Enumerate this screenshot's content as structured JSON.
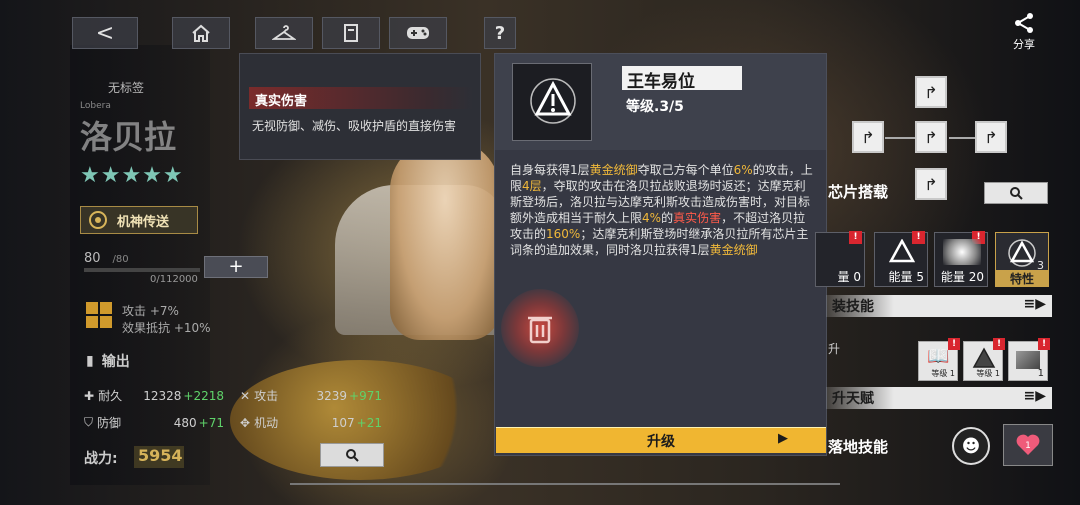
{
  "top": {
    "back_icon": "<",
    "share_label": "分享"
  },
  "character": {
    "tag": "无标签",
    "name_en": "Lobera",
    "name": "洛贝拉",
    "stars": "★★★★★",
    "teleport_label": "机神传送",
    "level": "80",
    "level_max": "/80",
    "exp": "0/112000",
    "plus_label": "+",
    "bonus_attack": "攻击 +7%",
    "bonus_resist": "效果抵抗 +10%",
    "role": "输出",
    "stats": [
      {
        "label": "耐久",
        "base": "12328",
        "bonus": "+2218"
      },
      {
        "label": "攻击",
        "base": "3239",
        "bonus": "+971"
      },
      {
        "label": "防御",
        "base": "480",
        "bonus": "+71"
      },
      {
        "label": "机动",
        "base": "107",
        "bonus": "+21"
      }
    ],
    "power_label": "战力:",
    "power_value": "5954"
  },
  "tooltip": {
    "title": "真实伤害",
    "body": "无视防御、减伤、吸收护盾的直接伤害"
  },
  "skill": {
    "name": "王车易位",
    "level": "等级.3/5",
    "desc_parts": [
      {
        "t": "自身每获得1层",
        "c": ""
      },
      {
        "t": "黄金统御",
        "c": "gold"
      },
      {
        "t": "夺取己方每个单位",
        "c": ""
      },
      {
        "t": "6%",
        "c": "gold"
      },
      {
        "t": "的攻击，上限",
        "c": ""
      },
      {
        "t": "4层",
        "c": "gold"
      },
      {
        "t": "，夺取的攻击在洛贝拉战败退场时返还；达摩克利斯登场后，洛贝拉与达摩克利斯攻击造成伤害时，对目标额外造成相当于耐久上限",
        "c": ""
      },
      {
        "t": "4%",
        "c": "gold"
      },
      {
        "t": "的",
        "c": ""
      },
      {
        "t": "真实伤害",
        "c": "red"
      },
      {
        "t": "，不超过洛贝拉攻击的",
        "c": ""
      },
      {
        "t": "160%",
        "c": "gold"
      },
      {
        "t": "；达摩克利斯登场时继承洛贝拉所有芯片主词条的追加效果，同时洛贝拉获得1层",
        "c": ""
      },
      {
        "t": "黄金统御",
        "c": "gold"
      }
    ],
    "upgrade_label": "升级",
    "upgrade_arrow": "▶"
  },
  "right": {
    "chip_label": "芯片搭载",
    "slots": [
      {
        "label": "量 0"
      },
      {
        "label": "能量 5"
      },
      {
        "label": "能量 20"
      },
      {
        "label": "特性",
        "level": "3"
      }
    ],
    "equip_skill_label": "装技能",
    "promote_label": "升",
    "talent_label": "升天赋",
    "small_icons": [
      {
        "level": "等级 1"
      },
      {
        "level": "等级 1"
      },
      {
        "level": "1"
      }
    ],
    "ground_skill_label": "落地技能",
    "badge": "!"
  }
}
